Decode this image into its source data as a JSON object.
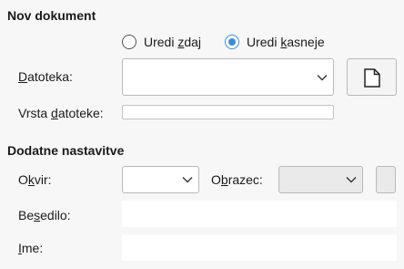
{
  "new_document": {
    "title": "Nov dokument",
    "radio_edit_now": {
      "pre": "Uredi ",
      "u": "z",
      "post": "daj",
      "selected": false
    },
    "radio_edit_later": {
      "pre": "Uredi ",
      "u": "k",
      "post": "asneje",
      "selected": true
    },
    "file_label": {
      "pre": "",
      "u": "D",
      "post": "atoteka:"
    },
    "file_value": "",
    "file_type_label": {
      "pre": "Vrsta ",
      "u": "d",
      "post": "atoteke:"
    },
    "file_type_value": ""
  },
  "additional_settings": {
    "title": "Dodatne nastavitve",
    "frame_label": {
      "pre": "O",
      "u": "k",
      "post": "vir:"
    },
    "frame_value": "",
    "style_label": {
      "pre": "O",
      "u": "b",
      "post": "razec:"
    },
    "style_value": "",
    "text_label": {
      "pre": "Be",
      "u": "s",
      "post": "edilo:"
    },
    "text_value": "",
    "name_label": {
      "pre": "",
      "u": "I",
      "post": "me:"
    },
    "name_value": ""
  },
  "icons": {
    "new_file": "document-icon",
    "dropdown": "chevron-down-icon"
  },
  "colors": {
    "accent": "#3b8fd8",
    "background": "#f7f7f7"
  }
}
